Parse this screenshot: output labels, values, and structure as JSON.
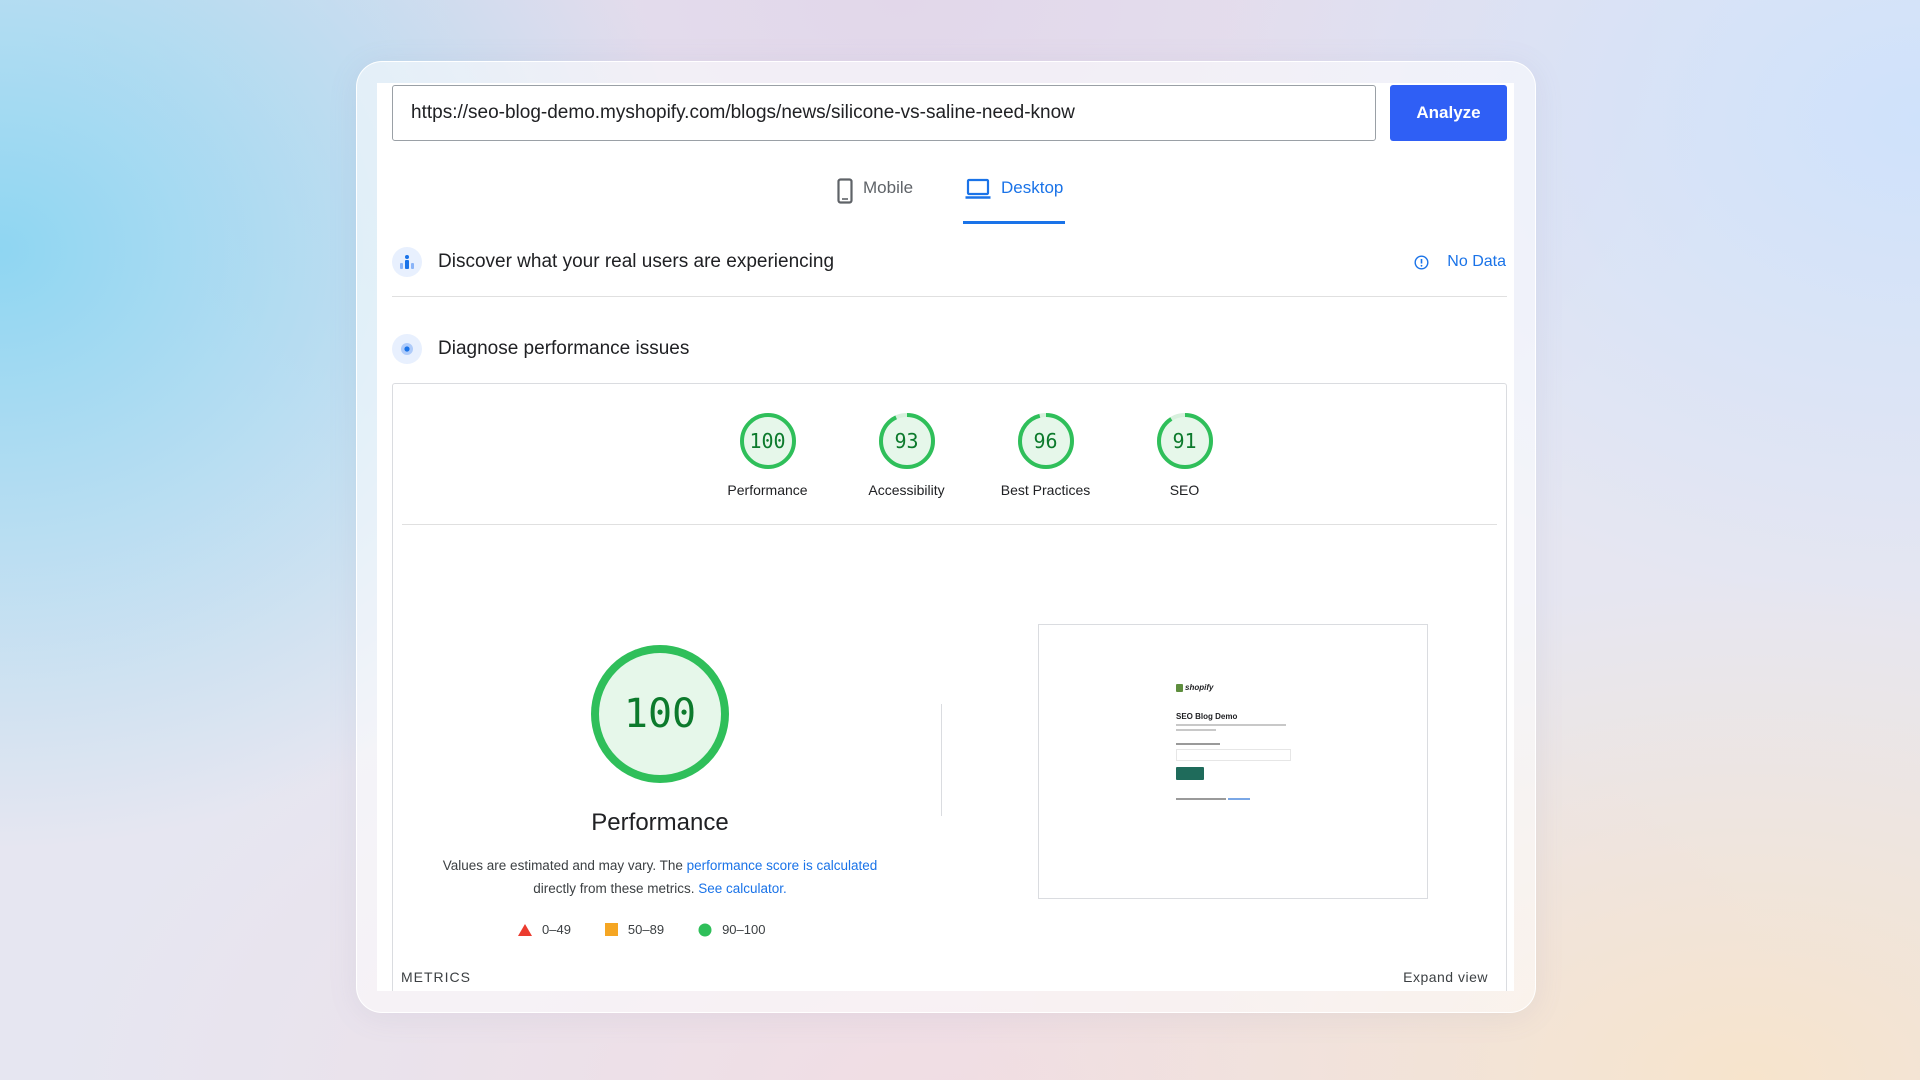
{
  "search": {
    "url_value": "https://seo-blog-demo.myshopify.com/blogs/news/silicone-vs-saline-need-know",
    "analyze_label": "Analyze"
  },
  "tabs": [
    {
      "label": "Mobile",
      "icon": "phone-icon",
      "active": false
    },
    {
      "label": "Desktop",
      "icon": "laptop-icon",
      "active": true
    }
  ],
  "field_data": {
    "title": "Discover what your real users are experiencing",
    "status": "No Data",
    "status_icon": "info-icon"
  },
  "lab_data": {
    "title": "Diagnose performance issues"
  },
  "scores": [
    {
      "value": "100",
      "label": "Performance"
    },
    {
      "value": "93",
      "label": "Accessibility"
    },
    {
      "value": "96",
      "label": "Best Practices"
    },
    {
      "value": "91",
      "label": "SEO"
    }
  ],
  "performance": {
    "score": "100",
    "title": "Performance",
    "desc_part1": "Values are estimated and may vary. The ",
    "desc_link1": "performance score is calculated",
    "desc_part2": "directly from these metrics. ",
    "desc_link2": "See calculator."
  },
  "legend": [
    {
      "range": "0–49",
      "marker": "triangle",
      "color": "#eb3b2f"
    },
    {
      "range": "50–89",
      "marker": "square",
      "color": "#f5a623"
    },
    {
      "range": "90–100",
      "marker": "circle",
      "color": "#2fbf5a"
    }
  ],
  "screenshot": {
    "brand": "shopify",
    "heading": "SEO Blog Demo"
  },
  "metrics": {
    "label": "METRICS",
    "expand_label": "Expand view"
  },
  "colors": {
    "accent": "#1a73e8",
    "button": "#2f5ff5",
    "pass": "#2fbf5a",
    "pass_text": "#0c7a2c"
  }
}
